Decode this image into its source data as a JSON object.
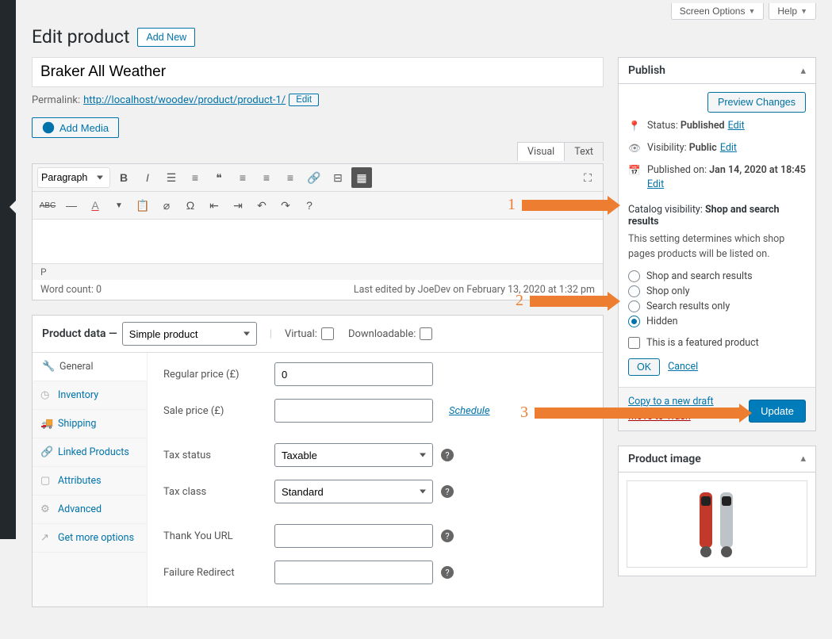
{
  "topTabs": {
    "screenOptions": "Screen Options",
    "help": "Help"
  },
  "pageTitle": "Edit product",
  "addNew": "Add New",
  "titleInput": "Braker All Weather",
  "permalink": {
    "label": "Permalink:",
    "url": "http://localhost/woodev/product/product-1/",
    "edit": "Edit"
  },
  "addMedia": "Add Media",
  "editorTabs": {
    "visual": "Visual",
    "text": "Text"
  },
  "paragraphSel": "Paragraph",
  "editorStatus": "P",
  "wordCountLabel": "Word count: 0",
  "lastEdited": "Last edited by JoeDev on February 13, 2020 at 1:32 pm",
  "productData": {
    "heading": "Product data",
    "typeSelect": "Simple product",
    "virtual": "Virtual:",
    "downloadable": "Downloadable:",
    "tabs": [
      "General",
      "Inventory",
      "Shipping",
      "Linked Products",
      "Attributes",
      "Advanced",
      "Get more options"
    ],
    "fields": {
      "regularPrice": "Regular price (£)",
      "regularPriceVal": "0",
      "salePrice": "Sale price (£)",
      "schedule": "Schedule",
      "taxStatus": "Tax status",
      "taxStatusVal": "Taxable",
      "taxClass": "Tax class",
      "taxClassVal": "Standard",
      "thankYou": "Thank You URL",
      "failureRedirect": "Failure Redirect"
    }
  },
  "publish": {
    "heading": "Publish",
    "preview": "Preview Changes",
    "statusLabel": "Status:",
    "statusVal": "Published",
    "edit": "Edit",
    "visLabel": "Visibility:",
    "visVal": "Public",
    "pubOnLabel": "Published on:",
    "pubOnVal": "Jan 14, 2020 at 18:45",
    "catalogLabel": "Catalog visibility:",
    "catalogVal": "Shop and search results",
    "catalogDesc": "This setting determines which shop pages products will be listed on.",
    "cvOptions": [
      "Shop and search results",
      "Shop only",
      "Search results only",
      "Hidden"
    ],
    "cvSelectedIndex": 3,
    "featured": "This is a featured product",
    "ok": "OK",
    "cancel": "Cancel",
    "copyDraft": "Copy to a new draft",
    "trash": "Move to Trash",
    "update": "Update"
  },
  "productImage": {
    "heading": "Product image"
  },
  "annotations": {
    "n1": "1",
    "n2": "2",
    "n3": "3"
  }
}
